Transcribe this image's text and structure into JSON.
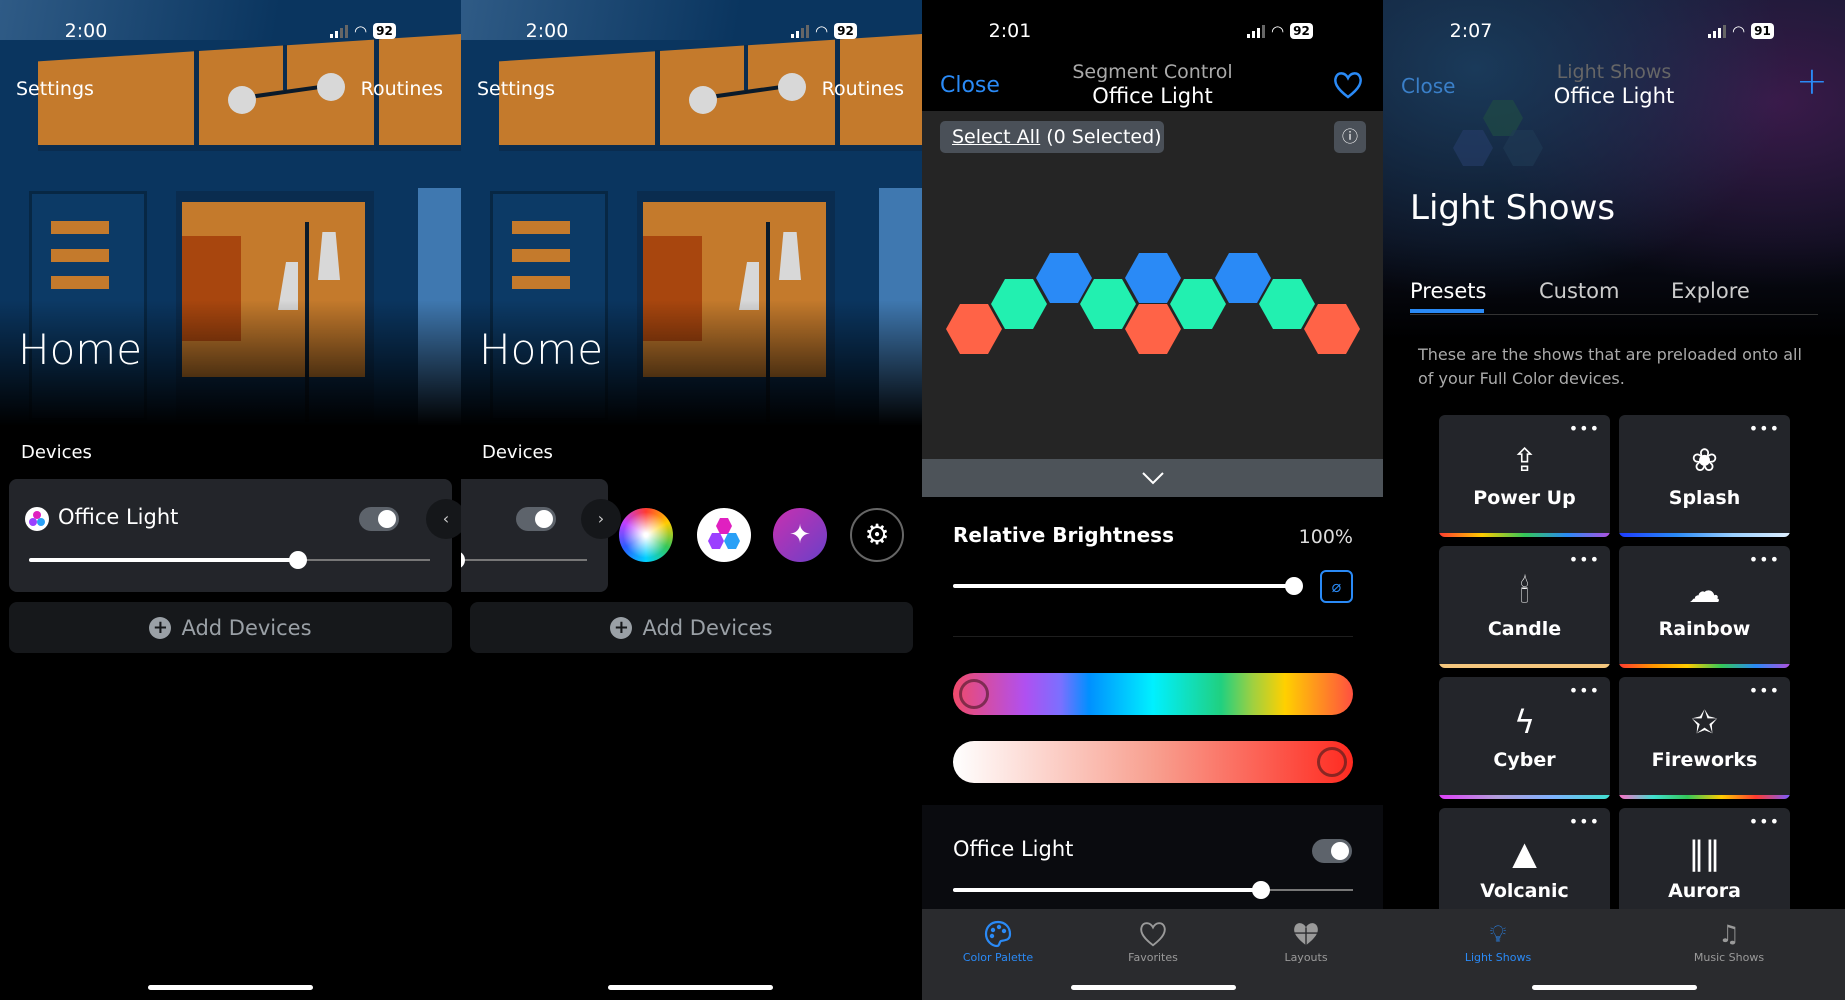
{
  "panels": [
    {
      "time": "2:00",
      "battery": "92",
      "settings": "Settings",
      "routines": "Routines",
      "title": "Home",
      "devices_label": "Devices",
      "device_name": "Office Light",
      "add_devices": "Add Devices",
      "brightness_pct": 67,
      "power": true
    },
    {
      "time": "2:00",
      "battery": "92",
      "settings": "Settings",
      "routines": "Routines",
      "title": "Home",
      "devices_label": "Devices",
      "add_devices": "Add Devices",
      "quick_actions": [
        "color-wheel-icon",
        "layout-hex-icon",
        "sparkle-scenes-icon",
        "gear-icon"
      ]
    },
    {
      "time": "2:01",
      "battery": "92",
      "close": "Close",
      "subtitle": "Segment Control",
      "title": "Office Light",
      "select_all": "Select All",
      "selected_count": "(0 Selected)",
      "hex_colors": [
        "#ff6347",
        "#22f0b0",
        "#2a8af6",
        "#22f0b0",
        "#ff6347",
        "#2a8af6",
        "#22f0b0",
        "#2a8af6",
        "#22f0b0",
        "#ff6347"
      ],
      "relative_brightness_label": "Relative Brightness",
      "relative_brightness_value": "100%",
      "relative_brightness": 100,
      "hue_position": 0,
      "saturation_position": 100,
      "device_name": "Office Light",
      "device_power": true,
      "device_brightness": 77
    },
    {
      "time": "2:07",
      "battery": "91",
      "close": "Close",
      "subtitle": "Light Shows",
      "title": "Office Light",
      "heading": "Light Shows",
      "tabs": [
        "Presets",
        "Custom",
        "Explore"
      ],
      "active_tab": "Presets",
      "description": "These are the shows that are preloaded onto all of your Full Color devices.",
      "shows": [
        {
          "name": "Power Up",
          "icon": "power-up-arrow-icon",
          "stripe": [
            "#ff3b30",
            "#ffcc00",
            "#34c759",
            "#2a8af6",
            "#af52de"
          ]
        },
        {
          "name": "Splash",
          "icon": "splash-icon",
          "stripe": [
            "#1e3cff",
            "#2a8af6",
            "#9ad0ff",
            "#e0f0ff"
          ]
        },
        {
          "name": "Candle",
          "icon": "candle-icon",
          "stripe": [
            "#f5c77e",
            "#f5c77e"
          ]
        },
        {
          "name": "Rainbow",
          "icon": "rainbow-cloud-icon",
          "stripe": [
            "#ff3b30",
            "#ff9500",
            "#ffcc00",
            "#34c759",
            "#2a8af6",
            "#af52de"
          ]
        },
        {
          "name": "Cyber",
          "icon": "lightning-icon",
          "stripe": [
            "#e040fb",
            "#b39ddb",
            "#7fb3ff",
            "#40e0d0"
          ]
        },
        {
          "name": "Fireworks",
          "icon": "fireworks-star-icon",
          "stripe": [
            "#ff6ec7",
            "#40e0d0",
            "#34c759",
            "#ffcc00",
            "#ff3b30",
            "#7a5cff"
          ]
        },
        {
          "name": "Volcanic",
          "icon": "mountain-icon",
          "stripe": []
        },
        {
          "name": "Aurora",
          "icon": "aurora-bars-icon",
          "stripe": []
        }
      ]
    }
  ],
  "tabbar": [
    {
      "label": "Color Palette",
      "icon": "palette-icon",
      "active": true
    },
    {
      "label": "Favorites",
      "icon": "heart-icon",
      "active": false
    },
    {
      "label": "Layouts",
      "icon": "layouts-heart-icon",
      "active": false
    },
    {
      "label": "Light Shows",
      "icon": "light-shows-bulb-icon",
      "active": true
    },
    {
      "label": "Music Shows",
      "icon": "music-shows-icon",
      "active": false
    }
  ],
  "colors": {
    "accent": "#2a8af6",
    "card": "#23252a",
    "tabbar": "#2a2b2e"
  }
}
